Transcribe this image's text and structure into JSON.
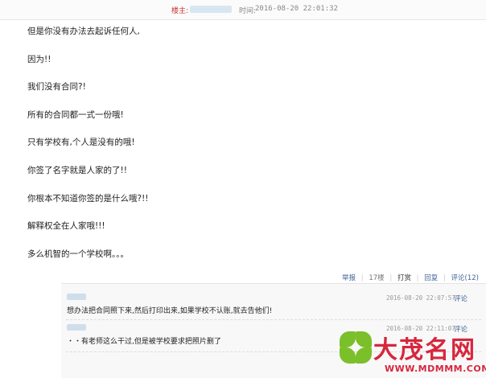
{
  "header": {
    "poster_label": "楼主:",
    "time_label": "时间:",
    "time_value": "2016-08-20 22:01:32"
  },
  "post": {
    "lines": [
      "但是你没有办法去起诉任何人,",
      "因为!!",
      "我们没有合同?!",
      "所有的合同都一式一份哦!",
      "只有学校有,个人是没有的哦!",
      "你签了名字就是人家的了!!",
      "你根本不知道你签的是什么哦?!!",
      "解释权全在人家哦!!!",
      "多么机智的一个学校啊。。。"
    ]
  },
  "actions": {
    "report": "举报",
    "floor": "17楼",
    "tip": "打赏",
    "reply": "回复",
    "comment": "评论(12)"
  },
  "comments": [
    {
      "time": "2016-08-20 22:07:57",
      "text": "想办法把合同照下来,然后打印出来,如果学校不认账,就去告他们!",
      "reply_label": "评论"
    },
    {
      "time": "2016-08-20 22:11:07",
      "text": "・・有老师这么干过,但是被学校要求把照片删了",
      "reply_label": "评论"
    }
  ],
  "watermark": {
    "cn": "大茂名网",
    "en": "WWW.MDMMM.COM"
  },
  "colors": {
    "accent": "#d7263d",
    "link": "#446699",
    "clover": "#7bbf2a"
  }
}
